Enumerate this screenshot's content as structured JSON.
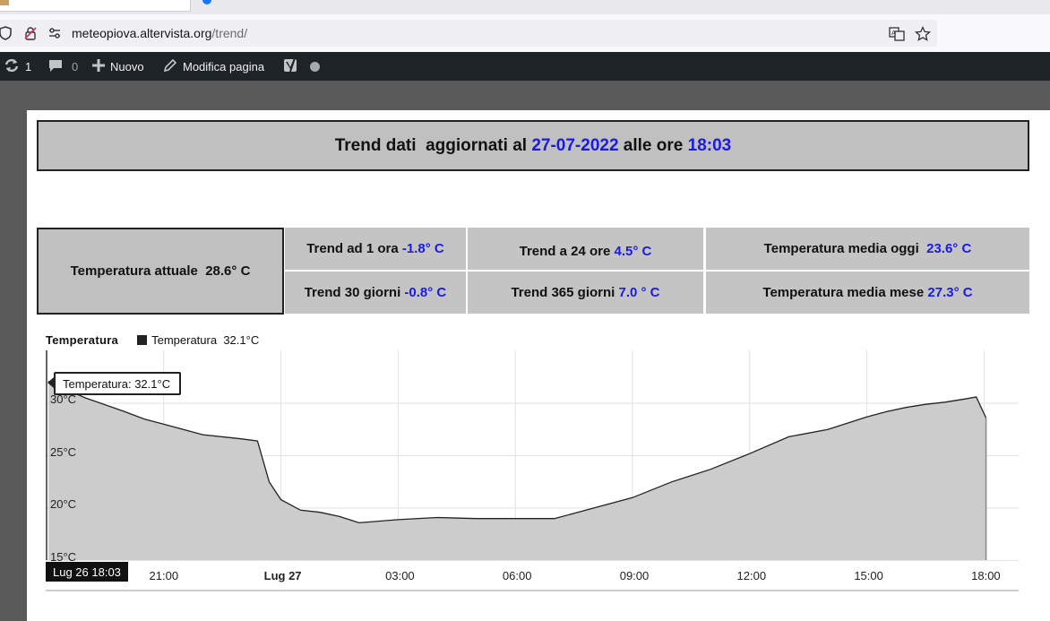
{
  "browser": {
    "url_host": "meteopiova.altervista.org",
    "url_path": "/trend/"
  },
  "wp_bar": {
    "updates_count": "1",
    "comments_count": "0",
    "new_label": "Nuovo",
    "edit_label": "Modifica pagina"
  },
  "header": {
    "prefix": "Trend dati  aggiornati al ",
    "date": "27-07-2022",
    "middle": " alle ore ",
    "time": "18:03"
  },
  "current": {
    "label": "Temperatura attuale",
    "value": "28.6° C"
  },
  "trends": [
    {
      "label": "Trend ad 1 ora",
      "value": "-1.8° C"
    },
    {
      "label": "Trend a 24 ore",
      "value": "4.5° C"
    },
    {
      "label": "Temperatura media oggi",
      "value": "23.6° C"
    },
    {
      "label": "Trend 30 giorni",
      "value": "-0.8° C"
    },
    {
      "label": "Trend 365 giorni",
      "value": "7.0 ° C"
    },
    {
      "label": "Temperatura media mese",
      "value": "27.3° C"
    }
  ],
  "chart_data": {
    "type": "area",
    "title": "Temperatura",
    "legend": [
      {
        "name": "Temperatura",
        "value": "32.1°C"
      }
    ],
    "tooltip": "Temperatura: 32.1°C",
    "crosshair_label": "Lug 26 18:03",
    "y_ticks": [
      "15°C",
      "20°C",
      "25°C",
      "30°C"
    ],
    "x_ticks": [
      "21:00",
      "Lug 27",
      "03:00",
      "06:00",
      "09:00",
      "12:00",
      "15:00",
      "18:00"
    ],
    "ylim": [
      15,
      35
    ],
    "x_unit": "hours since Lug 26 18:00",
    "color": "#cccccc",
    "series": [
      {
        "name": "Temperatura",
        "x": [
          0.05,
          0.5,
          1,
          2,
          2.5,
          3,
          4,
          5,
          5.4,
          5.7,
          6,
          6.5,
          7,
          7.5,
          8,
          9,
          10,
          11,
          12,
          12.5,
          13,
          13.5,
          14,
          15,
          16,
          17,
          18,
          19,
          20,
          20.5,
          21,
          21.5,
          22,
          22.5,
          23,
          23.5,
          23.8,
          24.05
        ],
        "values": [
          32.1,
          31.3,
          30.5,
          29.2,
          28.5,
          28.0,
          27.0,
          26.6,
          26.4,
          22.5,
          20.8,
          19.8,
          19.6,
          19.2,
          18.6,
          18.9,
          19.1,
          19.0,
          19.0,
          19.0,
          19.0,
          19.5,
          20.0,
          21.0,
          22.5,
          23.7,
          25.2,
          26.8,
          27.5,
          28.1,
          28.7,
          29.2,
          29.6,
          29.9,
          30.1,
          30.4,
          30.6,
          28.6
        ]
      }
    ]
  }
}
